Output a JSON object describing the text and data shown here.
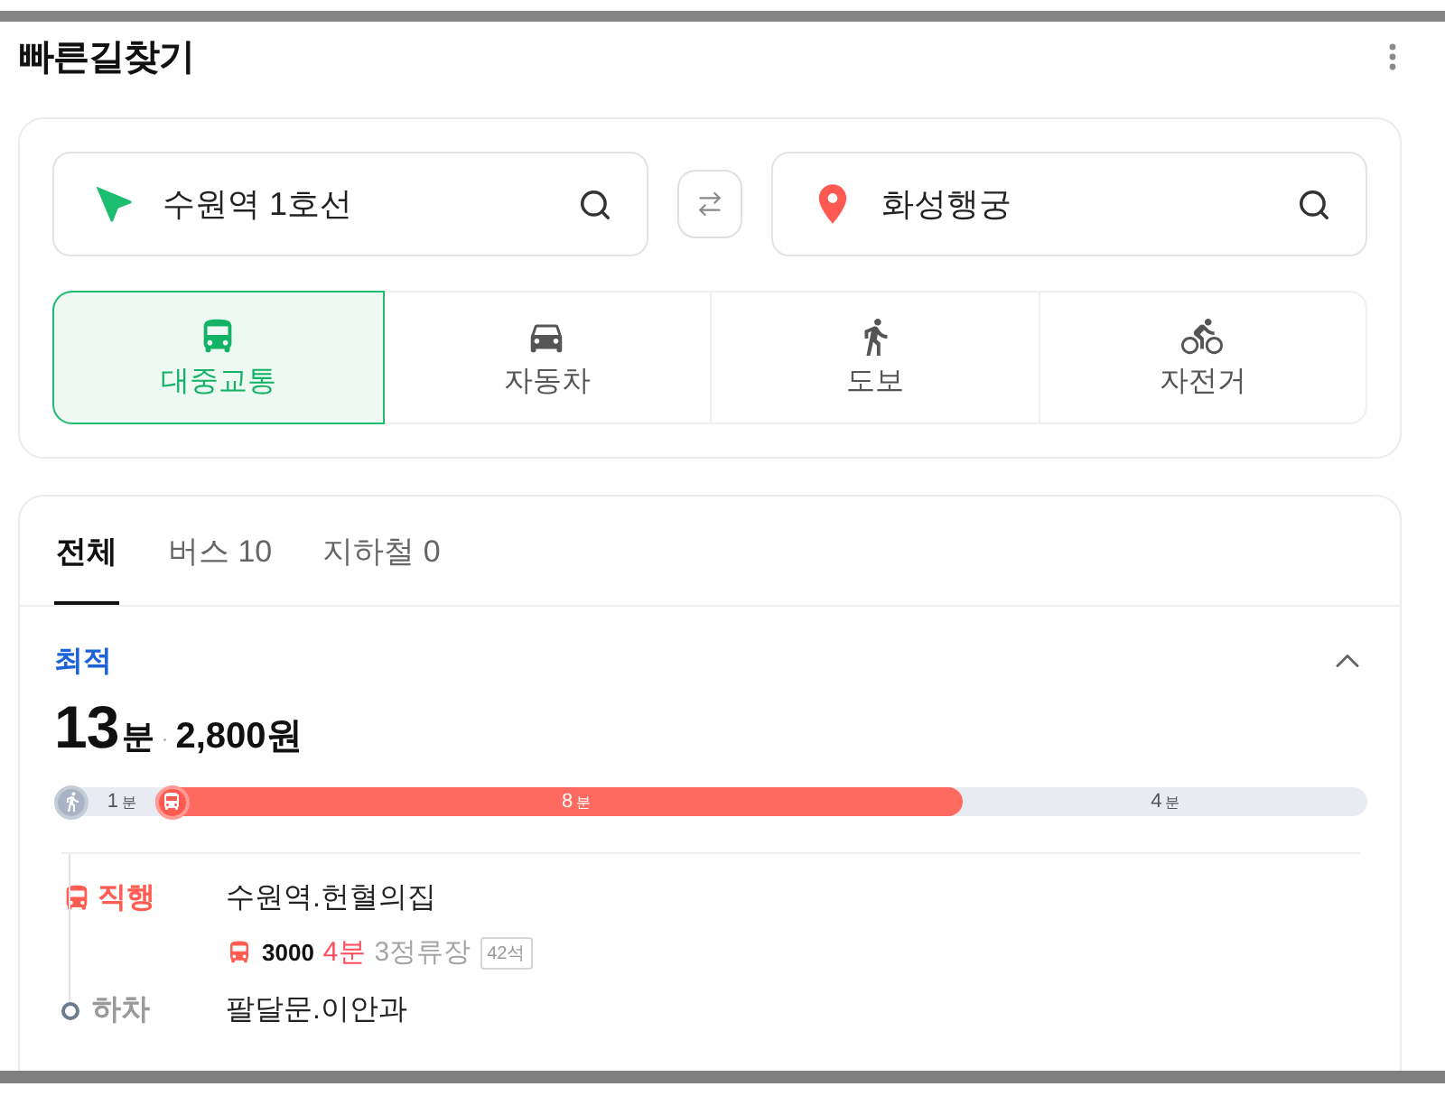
{
  "header": {
    "title": "빠른길찾기"
  },
  "search": {
    "origin": {
      "value": "수원역 1호선"
    },
    "destination": {
      "value": "화성행궁"
    }
  },
  "modes": [
    {
      "kind": "transit",
      "label": "대중교통",
      "selected": true
    },
    {
      "kind": "car",
      "label": "자동차",
      "selected": false
    },
    {
      "kind": "walk",
      "label": "도보",
      "selected": false
    },
    {
      "kind": "bike",
      "label": "자전거",
      "selected": false
    }
  ],
  "result_tabs": [
    {
      "label": "전체",
      "selected": true
    },
    {
      "label": "버스 10",
      "selected": false
    },
    {
      "label": "지하철 0",
      "selected": false
    }
  ],
  "route": {
    "badge": "최적",
    "expanded": true,
    "duration": {
      "value": "13",
      "unit": "분"
    },
    "separator": "·",
    "fare": "2,800원",
    "segments": [
      {
        "kind": "walk",
        "icon": true,
        "time": "1",
        "unit": "분"
      },
      {
        "kind": "bus",
        "icon": true,
        "time": "8",
        "unit": "분"
      },
      {
        "kind": "walk",
        "icon": false,
        "time": "4",
        "unit": "분"
      }
    ],
    "steps": [
      {
        "kind": "board",
        "label": "직행",
        "stop": "수원역.헌혈의집",
        "bus": {
          "number": "3000",
          "wait": "4분",
          "stops": "3정류장",
          "seats": "42석"
        }
      },
      {
        "kind": "alight",
        "label": "하차",
        "stop": "팔달문.이안과"
      }
    ]
  }
}
